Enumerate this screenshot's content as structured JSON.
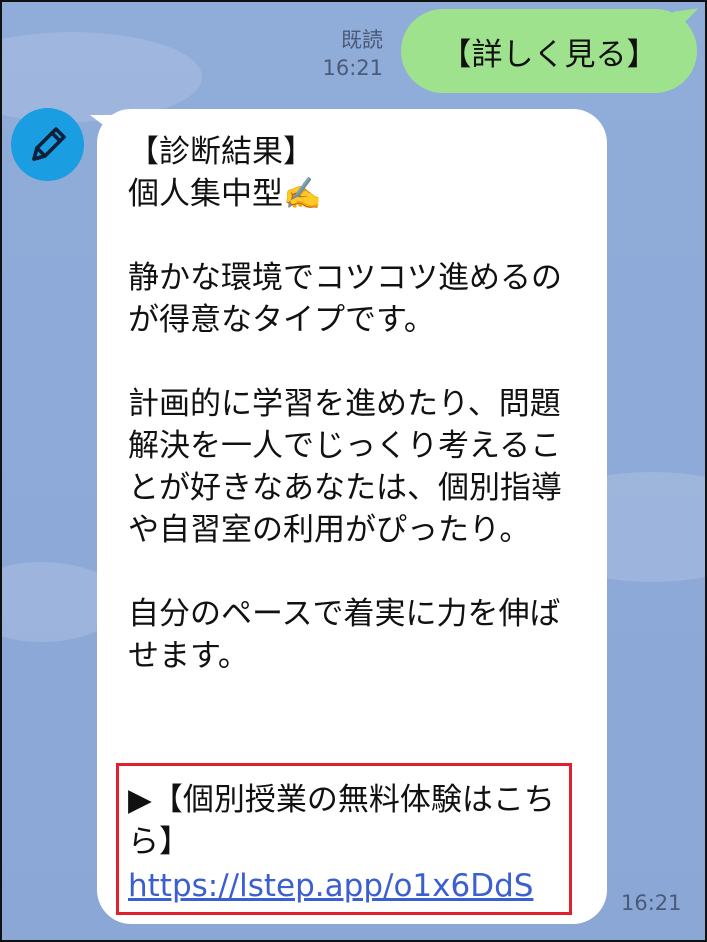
{
  "chat": {
    "sent": {
      "read_label": "既読",
      "time": "16:21",
      "text": "【詳しく見る】"
    },
    "received": {
      "avatar_icon": "pencil-icon",
      "avatar_color": "#1a9de1",
      "text": "【診断結果】\n個人集中型✍️\n\n静かな環境でコツコツ進めるのが得意なタイプです。\n\n計画的に学習を進めたり、問題解決を一人でじっくり考えることが好きなあなたは、個別指導や自習室の利用がぴったり。\n\n自分のペースで着実に力を伸ばせます。",
      "link_label": "▶【個別授業の無料体験はこちら】",
      "link_url": "https://lstep.app/o1x6DdS",
      "time": "16:21"
    }
  },
  "colors": {
    "background": "#8ba7d6",
    "sent_bubble": "#9fe28d",
    "received_bubble": "#ffffff",
    "highlight_border": "#e0202a",
    "link": "#3b5fd0"
  }
}
